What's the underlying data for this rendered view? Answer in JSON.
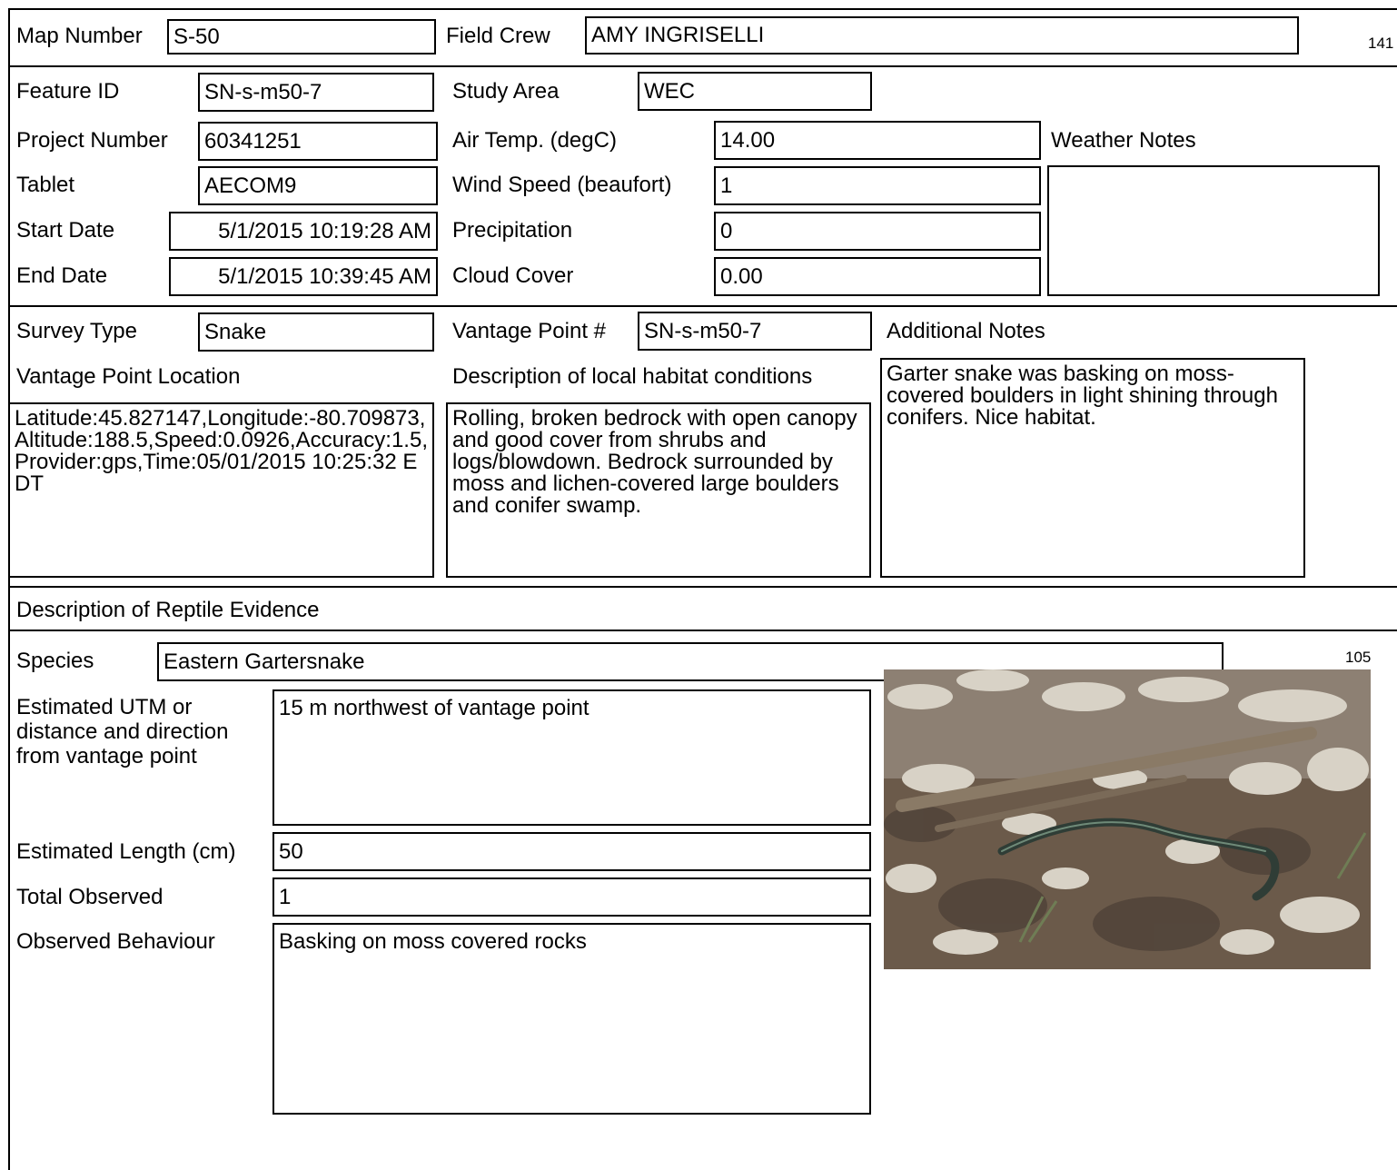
{
  "header": {
    "map_number_label": "Map Number",
    "map_number": "S-50",
    "field_crew_label": "Field Crew",
    "field_crew": "AMY INGRISELLI",
    "page_ref_top": "141"
  },
  "site": {
    "feature_id_label": "Feature ID",
    "feature_id": "SN-s-m50-7",
    "study_area_label": "Study Area",
    "study_area": "WEC",
    "project_number_label": "Project Number",
    "project_number": "60341251",
    "air_temp_label": "Air Temp. (degC)",
    "air_temp": "14.00",
    "weather_notes_label": "Weather Notes",
    "weather_notes": "",
    "tablet_label": "Tablet",
    "tablet": "AECOM9",
    "wind_speed_label": "Wind Speed (beaufort)",
    "wind_speed": "1",
    "start_date_label": "Start Date",
    "start_date": "5/1/2015 10:19:28 AM",
    "precipitation_label": "Precipitation",
    "precipitation": "0",
    "end_date_label": "End Date",
    "end_date": "5/1/2015 10:39:45 AM",
    "cloud_cover_label": "Cloud Cover",
    "cloud_cover": "0.00"
  },
  "survey": {
    "survey_type_label": "Survey Type",
    "survey_type": "Snake",
    "vantage_point_label": "Vantage Point #",
    "vantage_point": "SN-s-m50-7",
    "additional_notes_label": "Additional Notes",
    "additional_notes": "Garter snake was basking on moss-covered boulders in light shining through conifers. Nice habitat.",
    "vantage_location_label": "Vantage Point Location",
    "vantage_location": "Latitude:45.827147,Longitude:-80.709873,Altitude:188.5,Speed:0.0926,Accuracy:1.5,Provider:gps,Time:05/01/2015 10:25:32 EDT",
    "habitat_label": "Description of local habitat conditions",
    "habitat": "Rolling,  broken bedrock with open canopy and good cover from shrubs and logs/blowdown. Bedrock surrounded by moss and lichen-covered large boulders and conifer swamp."
  },
  "evidence": {
    "section_label": "Description of Reptile Evidence",
    "species_label": "Species",
    "species": "Eastern Gartersnake",
    "page_ref": "105",
    "utm_label": "Estimated UTM or distance and direction from vantage point",
    "utm": "15 m northwest of vantage point",
    "length_label": "Estimated Length (cm)",
    "length": "50",
    "total_label": "Total Observed",
    "total": "1",
    "behaviour_label": "Observed Behaviour",
    "behaviour": "Basking on moss covered rocks"
  },
  "photo": {
    "icon": "snake-photo",
    "colors": {
      "ground": "#6b5a4a",
      "leaves": "#d8d2c6",
      "snake": "#2f3d36",
      "log": "#8a7a66"
    }
  }
}
